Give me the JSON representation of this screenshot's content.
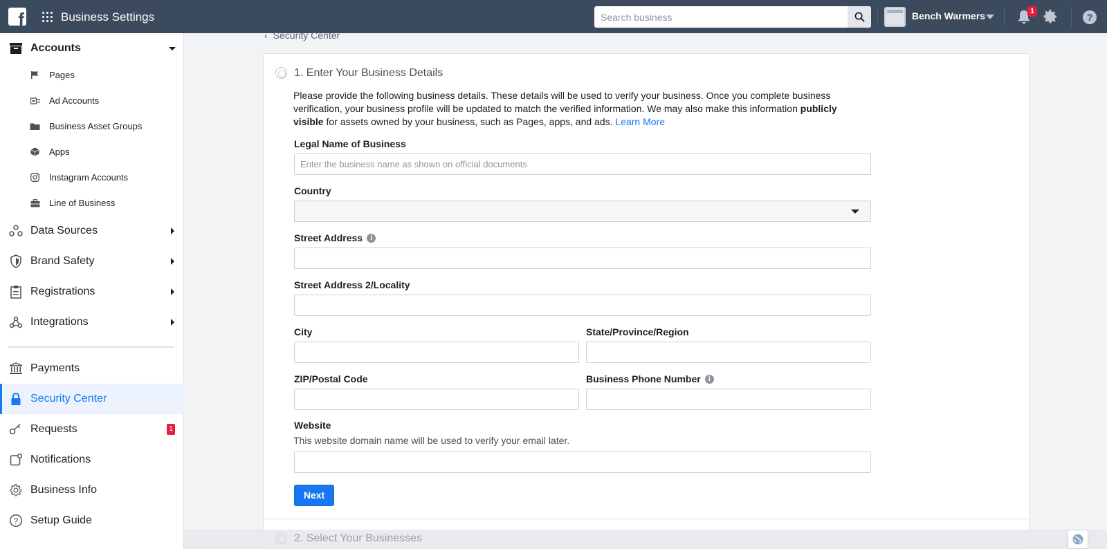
{
  "app": {
    "title": "Business Settings"
  },
  "search": {
    "placeholder": "Search business"
  },
  "account": {
    "business_name": "Bench Warmers",
    "notification_count": "1"
  },
  "sidebar": {
    "accounts": {
      "label": "Accounts",
      "items": [
        {
          "label": "Pages",
          "icon": "flag-icon"
        },
        {
          "label": "Ad Accounts",
          "icon": "ad-account-icon"
        },
        {
          "label": "Business Asset Groups",
          "icon": "folder-icon"
        },
        {
          "label": "Apps",
          "icon": "cube-icon"
        },
        {
          "label": "Instagram Accounts",
          "icon": "instagram-icon"
        },
        {
          "label": "Line of Business",
          "icon": "briefcase-icon"
        }
      ]
    },
    "sections": [
      {
        "label": "Data Sources",
        "icon": "data-sources-icon"
      },
      {
        "label": "Brand Safety",
        "icon": "shield-icon"
      },
      {
        "label": "Registrations",
        "icon": "clipboard-icon"
      },
      {
        "label": "Integrations",
        "icon": "integrations-icon"
      }
    ],
    "bottom": [
      {
        "label": "Payments",
        "icon": "bank-icon"
      },
      {
        "label": "Security Center",
        "icon": "lock-icon"
      },
      {
        "label": "Requests",
        "icon": "key-icon",
        "badge": "1"
      },
      {
        "label": "Notifications",
        "icon": "notification-icon"
      },
      {
        "label": "Business Info",
        "icon": "gear-icon"
      },
      {
        "label": "Setup Guide",
        "icon": "question-icon"
      }
    ]
  },
  "main": {
    "breadcrumb": "Security Center",
    "step1_title": "1. Enter Your Business Details",
    "description_part1": "Please provide the following business details. These details will be used to verify your business. Once you complete business verification, your business profile will be updated to match the verified information. We may also make this information ",
    "description_bold": "publicly visible",
    "description_part2": " for assets owned by your business, such as Pages, apps, and ads. ",
    "description_link": "Learn More",
    "fields": {
      "legal_name_label": "Legal Name of Business",
      "legal_name_placeholder": "Enter the business name as shown on official documents",
      "country_label": "Country",
      "street_label": "Street Address",
      "street2_label": "Street Address 2/Locality",
      "city_label": "City",
      "state_label": "State/Province/Region",
      "zip_label": "ZIP/Postal Code",
      "phone_label": "Business Phone Number",
      "website_label": "Website",
      "website_help": "This website domain name will be used to verify your email later."
    },
    "next_label": "Next",
    "step2_title": "2. Select Your Businesses"
  },
  "colors": {
    "topbar": "#3b4a5c",
    "accent": "#1877f2",
    "badge": "#e41e3f"
  }
}
